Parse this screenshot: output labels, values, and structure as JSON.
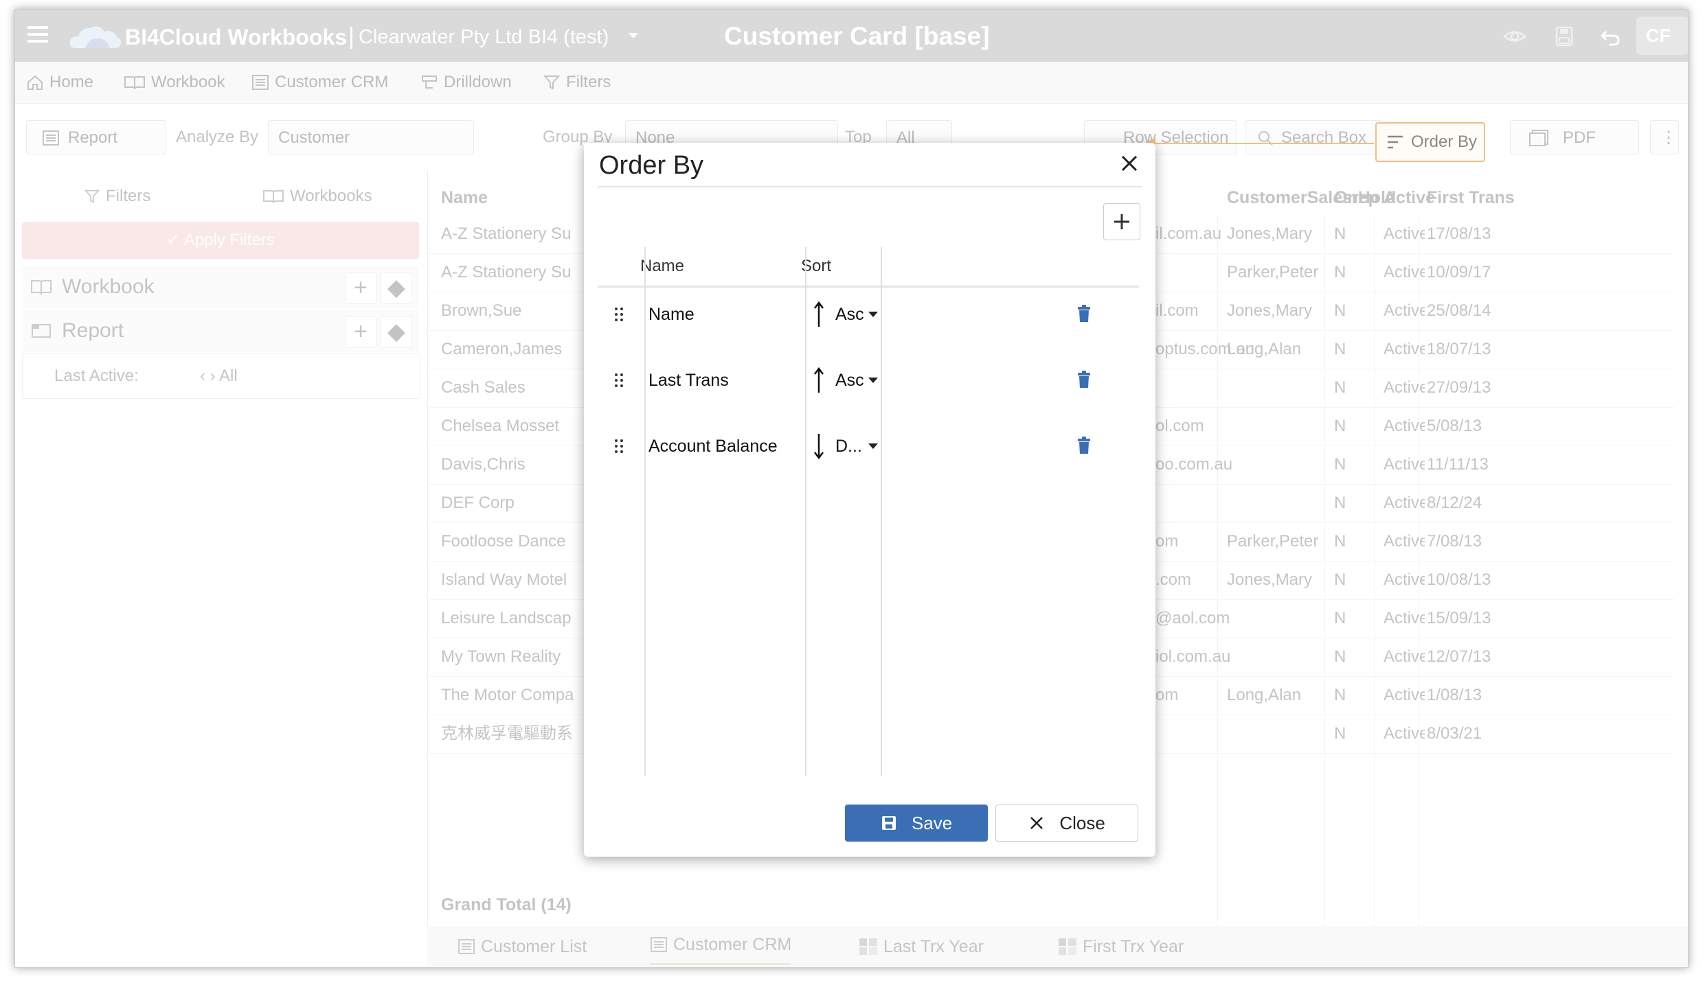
{
  "app": {
    "title": "BI4Cloud Workbooks",
    "separator": "|",
    "company": "Clearwater Pty Ltd BI4 (test)",
    "page_title": "Customer Card [base]",
    "avatar": "CF"
  },
  "nav": {
    "home": "Home",
    "workbook": "Workbook",
    "customer_crm": "Customer CRM",
    "drilldown": "Drilldown",
    "filters": "Filters"
  },
  "toolbar": {
    "report": "Report",
    "analyze_by_label": "Analyze By",
    "analyze_by_value": "Customer",
    "group_by_label": "Group By",
    "group_by_value": "None",
    "top_label": "Top",
    "top_value": "All",
    "row_selection": "Row Selection",
    "search_box": "Search Box",
    "order_by": "Order By",
    "pdf": "PDF"
  },
  "left_panel": {
    "tab_filters": "Filters",
    "tab_workbooks": "Workbooks",
    "apply_filters": "Apply Filters",
    "workbook": "Workbook",
    "report": "Report",
    "last_active_label": "Last Active:",
    "last_active_value": "All"
  },
  "grid": {
    "headers": {
      "name": "Name",
      "salesrep": "CustomerSalesrep",
      "onhold": "OnHold",
      "active": "Active",
      "first_trans": "First Trans"
    },
    "rows": [
      {
        "name": "A-Z Stationery Su",
        "email": "il.com.au",
        "rep": "Jones,Mary",
        "onhold": "N",
        "active": "Active",
        "first": "17/08/13"
      },
      {
        "name": "A-Z Stationery Su",
        "email": "",
        "rep": "Parker,Peter",
        "onhold": "N",
        "active": "Active",
        "first": "10/09/17"
      },
      {
        "name": "Brown,Sue",
        "email": "il.com",
        "rep": "Jones,Mary",
        "onhold": "N",
        "active": "Active",
        "first": "25/08/14"
      },
      {
        "name": "Cameron,James",
        "email": "optus.com.au",
        "rep": "Long,Alan",
        "onhold": "N",
        "active": "Active",
        "first": "18/07/13"
      },
      {
        "name": "Cash Sales",
        "email": "",
        "rep": "",
        "onhold": "N",
        "active": "Active",
        "first": "27/09/13"
      },
      {
        "name": "Chelsea Mosset",
        "email": "ol.com",
        "rep": "",
        "onhold": "N",
        "active": "Active",
        "first": "5/08/13"
      },
      {
        "name": "Davis,Chris",
        "email": "oo.com.au",
        "rep": "",
        "onhold": "N",
        "active": "Active",
        "first": "11/11/13"
      },
      {
        "name": "DEF Corp",
        "email": "",
        "rep": "",
        "onhold": "N",
        "active": "Active",
        "first": "8/12/24"
      },
      {
        "name": "Footloose Dance",
        "email": "om",
        "rep": "Parker,Peter",
        "onhold": "N",
        "active": "Active",
        "first": "7/08/13"
      },
      {
        "name": "Island Way Motel",
        "email": ".com",
        "rep": "Jones,Mary",
        "onhold": "N",
        "active": "Active",
        "first": "10/08/13"
      },
      {
        "name": "Leisure Landscap",
        "email": "@aol.com",
        "rep": "",
        "onhold": "N",
        "active": "Active",
        "first": "15/09/13"
      },
      {
        "name": "My Town Reality",
        "email": "iol.com.au",
        "rep": "",
        "onhold": "N",
        "active": "Active",
        "first": "12/07/13"
      },
      {
        "name": "The Motor Compa",
        "email": "om",
        "rep": "Long,Alan",
        "onhold": "N",
        "active": "Active",
        "first": "1/08/13"
      },
      {
        "name": "克林威孚電驅動系",
        "email": "",
        "rep": "",
        "onhold": "N",
        "active": "Active",
        "first": "8/03/21"
      }
    ],
    "grand_total": "Grand Total (14)"
  },
  "bottom_tabs": [
    "Customer List",
    "Customer CRM",
    "Last Trx Year",
    "First Trx Year"
  ],
  "modal": {
    "title": "Order By",
    "col_name": "Name",
    "col_sort": "Sort",
    "rows": [
      {
        "name": "Name",
        "sort": "Asc",
        "direction": "up"
      },
      {
        "name": "Last Trans",
        "sort": "Asc",
        "direction": "up"
      },
      {
        "name": "Account Balance",
        "sort": "D...",
        "direction": "down"
      }
    ],
    "save": "Save",
    "close": "Close"
  },
  "colors": {
    "accent_orange": "#e8912b",
    "save_blue": "#3a6fb5",
    "trash_blue": "#3a6fb5",
    "topbar_gray": "#bfbfbf"
  }
}
